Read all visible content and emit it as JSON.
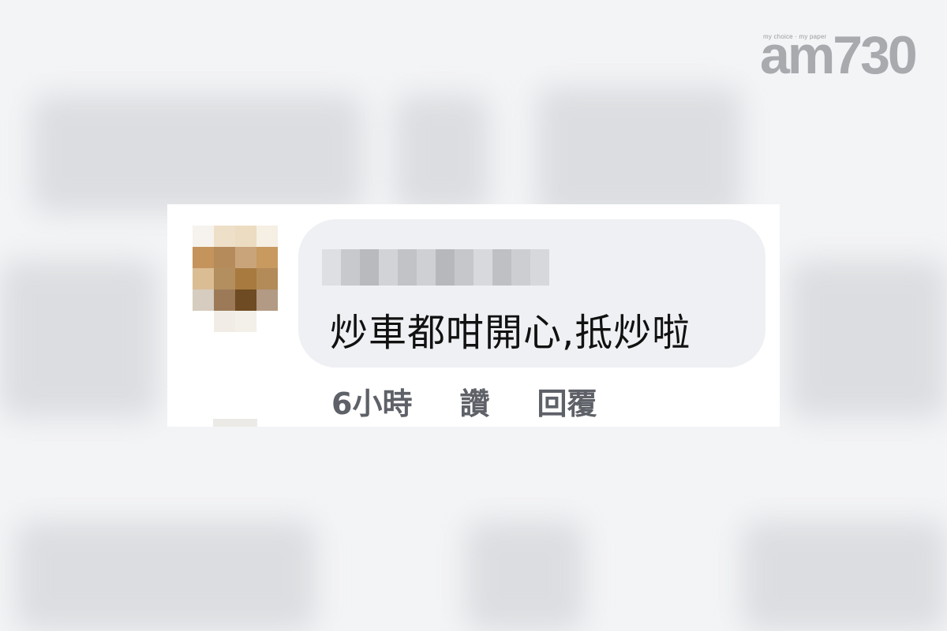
{
  "logo": {
    "tagline": "my choice · my paper",
    "mark": "am730"
  },
  "comment": {
    "text": "炒車都咁開心,抵炒啦",
    "timestamp": "6小時",
    "like_label": "讚",
    "reply_label": "回覆"
  },
  "colors": {
    "bubble_bg": "#eff0f3",
    "action_text": "#5e6168",
    "comment_text": "#111111"
  }
}
